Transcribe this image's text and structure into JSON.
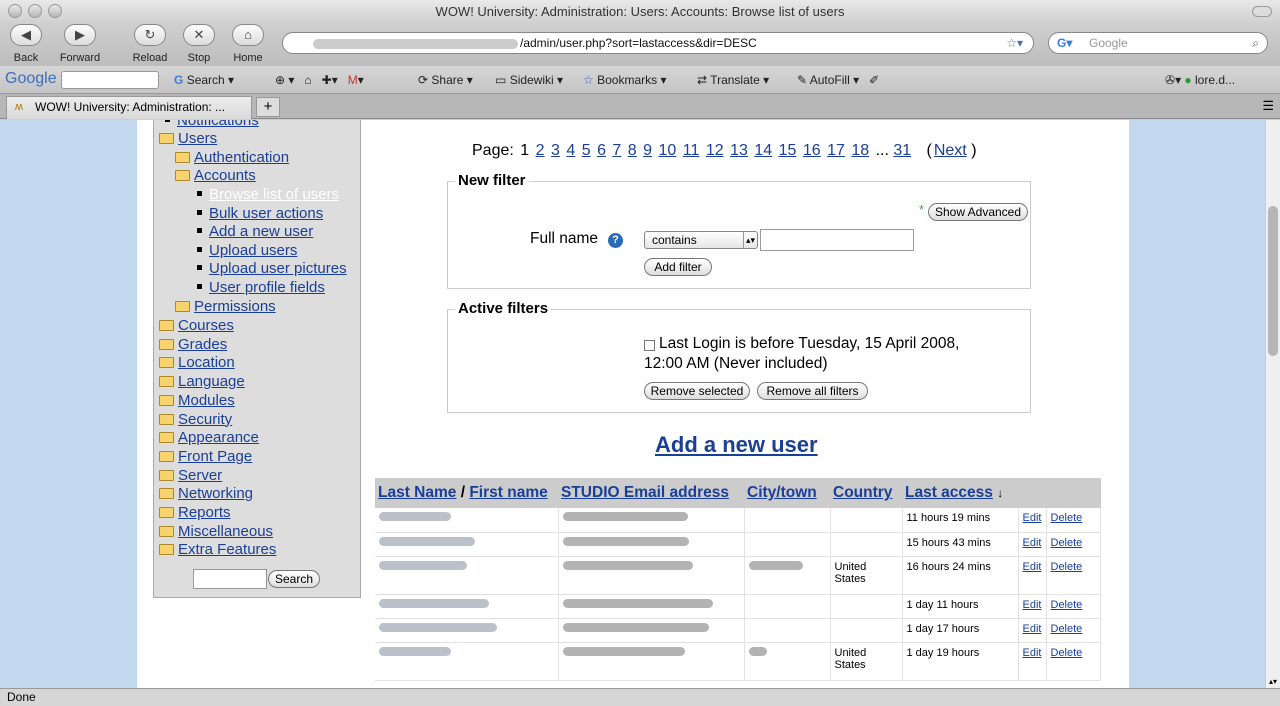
{
  "window": {
    "title": "WOW! University: Administration: Users: Accounts: Browse list of users"
  },
  "nav": {
    "back": "Back",
    "forward": "Forward",
    "reload": "Reload",
    "stop": "Stop",
    "home": "Home"
  },
  "url": {
    "path": "/admin/user.php?sort=lastaccess&dir=DESC"
  },
  "search": {
    "placeholder": "Google"
  },
  "toolbar": {
    "google": "Google",
    "search": "Search",
    "share": "Share",
    "sidewiki": "Sidewiki",
    "bookmarks": "Bookmarks",
    "translate": "Translate",
    "autofill": "AutoFill",
    "account": "lore.d..."
  },
  "tab": {
    "title": "WOW! University: Administration: ..."
  },
  "status": "Done",
  "sidebar": {
    "items": [
      {
        "label": "Notifications",
        "type": "bullet"
      },
      {
        "label": "Users",
        "type": "folder"
      },
      {
        "label": "Authentication",
        "type": "folder"
      },
      {
        "label": "Accounts",
        "type": "folder"
      },
      {
        "label": "Browse list of users",
        "type": "bullet"
      },
      {
        "label": "Bulk user actions",
        "type": "bullet"
      },
      {
        "label": "Add a new user",
        "type": "bullet"
      },
      {
        "label": "Upload users",
        "type": "bullet"
      },
      {
        "label": "Upload user pictures",
        "type": "bullet"
      },
      {
        "label": "User profile fields",
        "type": "bullet"
      },
      {
        "label": "Permissions",
        "type": "folder"
      },
      {
        "label": "Courses",
        "type": "folder"
      },
      {
        "label": "Grades",
        "type": "folder"
      },
      {
        "label": "Location",
        "type": "folder"
      },
      {
        "label": "Language",
        "type": "folder"
      },
      {
        "label": "Modules",
        "type": "folder"
      },
      {
        "label": "Security",
        "type": "folder"
      },
      {
        "label": "Appearance",
        "type": "folder"
      },
      {
        "label": "Front Page",
        "type": "folder"
      },
      {
        "label": "Server",
        "type": "folder"
      },
      {
        "label": "Networking",
        "type": "folder"
      },
      {
        "label": "Reports",
        "type": "folder"
      },
      {
        "label": "Miscellaneous",
        "type": "folder"
      },
      {
        "label": "Extra Features",
        "type": "folder"
      }
    ],
    "search_button": "Search"
  },
  "paging": {
    "label": "Page:",
    "current": "1",
    "pages": [
      "2",
      "3",
      "4",
      "5",
      "6",
      "7",
      "8",
      "9",
      "10",
      "11",
      "12",
      "13",
      "14",
      "15",
      "16",
      "17",
      "18"
    ],
    "ellipsis": "...",
    "last": "31",
    "next": "Next"
  },
  "new_filter": {
    "legend": "New filter",
    "asterisk": "*",
    "show_advanced": "Show Advanced",
    "field_label": "Full name",
    "operator": "contains",
    "add_filter": "Add filter"
  },
  "active_filters": {
    "legend": "Active filters",
    "filter_text_1": "Last Login is before Tuesday, 15 April 2008,",
    "filter_text_2": "12:00 AM (Never included)",
    "remove_selected": "Remove selected",
    "remove_all": "Remove all filters"
  },
  "add_new_user": "Add a new user",
  "table": {
    "headers": {
      "last_name": "Last Name",
      "slash": "/",
      "first_name": "First name",
      "email": "STUDIO Email address",
      "city": "City/town",
      "country": "Country",
      "last_access": "Last access",
      "sort_arrow": "↓"
    },
    "edit": "Edit",
    "delete": "Delete",
    "rows": [
      {
        "country": "",
        "last_access": "11 hours 19 mins"
      },
      {
        "country": "",
        "last_access": "15 hours 43 mins"
      },
      {
        "country": "United States",
        "last_access": "16 hours 24 mins"
      },
      {
        "country": "",
        "last_access": "1 day 11 hours"
      },
      {
        "country": "",
        "last_access": "1 day 17 hours"
      },
      {
        "country": "United States",
        "last_access": "1 day 19 hours"
      }
    ]
  }
}
